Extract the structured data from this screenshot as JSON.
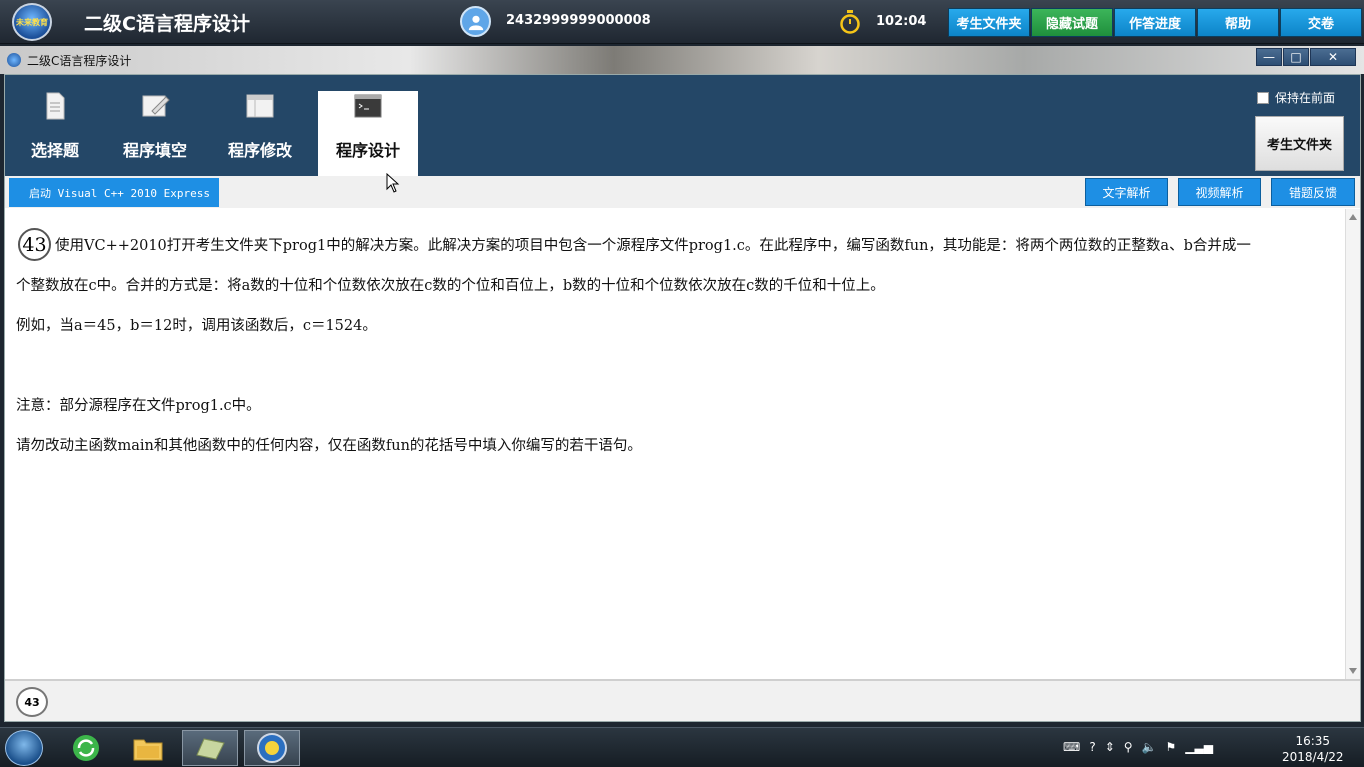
{
  "topbar": {
    "app_title": "二级C语言程序设计",
    "logo_text": "未来教育",
    "exam_id": "2432999999000008",
    "timer": "102:04",
    "buttons": [
      "考生文件夹",
      "隐藏试题",
      "作答进度",
      "帮助",
      "交卷"
    ],
    "accent_blue": "#0d84c8",
    "accent_green": "#1f8f3c"
  },
  "window": {
    "title": "二级C语言程序设计",
    "controls": [
      "—",
      "□",
      "✕"
    ]
  },
  "tabs": [
    {
      "label": "选择题",
      "icon": "document-icon"
    },
    {
      "label": "程序填空",
      "icon": "edit-icon"
    },
    {
      "label": "程序修改",
      "icon": "window-icon"
    },
    {
      "label": "程序设计",
      "icon": "terminal-icon"
    }
  ],
  "active_tab": "程序设计",
  "options": {
    "keep_front": "保持在前面",
    "folder_button": "考生文件夹"
  },
  "toolbar": {
    "launch_label": "启动 Visual C++ 2010 Express",
    "text_analysis": "文字解析",
    "video_analysis": "视频解析",
    "error_feedback": "错题反馈"
  },
  "question": {
    "number": "43",
    "line1": "使用VC++2010打开考生文件夹下prog1中的解决方案。此解决方案的项目中包含一个源程序文件prog1.c。在此程序中，编写函数fun，其功能是：将两个两位数的正整数a、b合并成一",
    "line2": "个整数放在c中。合并的方式是：将a数的十位和个位数依次放在c数的个位和百位上，b数的十位和个位数依次放在c数的千位和十位上。",
    "line3": "例如，当a＝45，b＝12时，调用该函数后，c＝1524。",
    "line4": "注意：部分源程序在文件prog1.c中。",
    "line5": "请勿改动主函数main和其他函数中的任何内容，仅在函数fun的花括号中填入你编写的若干语句。"
  },
  "bottom": {
    "question_chip": "43"
  },
  "taskbar": {
    "time": "16:35",
    "date": "2018/4/22"
  }
}
